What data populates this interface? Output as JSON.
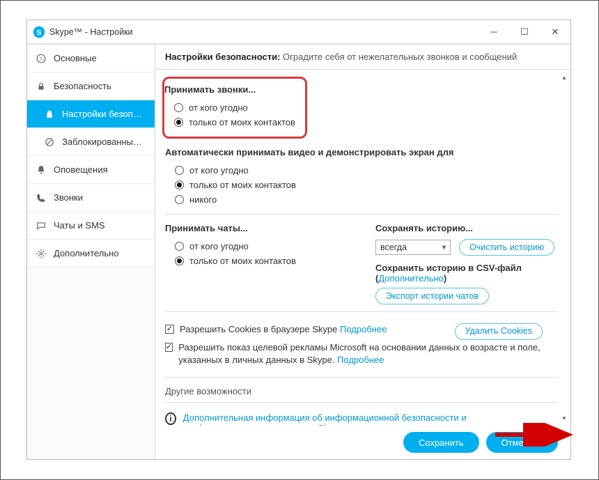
{
  "window": {
    "title": "Skype™ - Настройки"
  },
  "sidebar": {
    "items": [
      {
        "label": "Основные"
      },
      {
        "label": "Безопасность"
      },
      {
        "label": "Настройки безопасно..."
      },
      {
        "label": "Заблокированные по..."
      },
      {
        "label": "Оповещения"
      },
      {
        "label": "Звонки"
      },
      {
        "label": "Чаты и SMS"
      },
      {
        "label": "Дополнительно"
      }
    ]
  },
  "header": {
    "title": "Настройки безопасности:",
    "subtitle": "Оградите себя от нежелательных звонков и сообщений"
  },
  "calls": {
    "title": "Принимать звонки...",
    "opt_anyone": "от кого угодно",
    "opt_contacts": "только от моих контактов"
  },
  "video": {
    "title": "Автоматически принимать видео и демонстрировать экран для",
    "opt_anyone": "от кого угодно",
    "opt_contacts": "только от моих контактов",
    "opt_nobody": "никого"
  },
  "chats": {
    "title": "Принимать чаты...",
    "opt_anyone": "от кого угодно",
    "opt_contacts": "только от моих контактов"
  },
  "history": {
    "title": "Сохранять историю...",
    "select_value": "всегда",
    "clear_btn": "Очистить историю",
    "csv_label_pre": "Сохранить историю в CSV-файл (",
    "csv_link": "Дополнительно",
    "csv_label_post": ")",
    "export_btn": "Экспорт истории чатов"
  },
  "cookies": {
    "cb1_label": "Разрешить Cookies в браузере Skype",
    "cb1_more": "Подробнее",
    "delete_btn": "Удалить Cookies",
    "cb2_label": "Разрешить показ целевой рекламы Microsoft на основании данных о возрасте и поле, указанных в личных данных в Skype.",
    "cb2_more": "Подробнее"
  },
  "other": {
    "title": "Другие возможности",
    "info": "Дополнительная информация об информационной безопасности и конфиденциальности данных в Skype"
  },
  "footer": {
    "save": "Сохранить",
    "cancel": "Отменить"
  }
}
